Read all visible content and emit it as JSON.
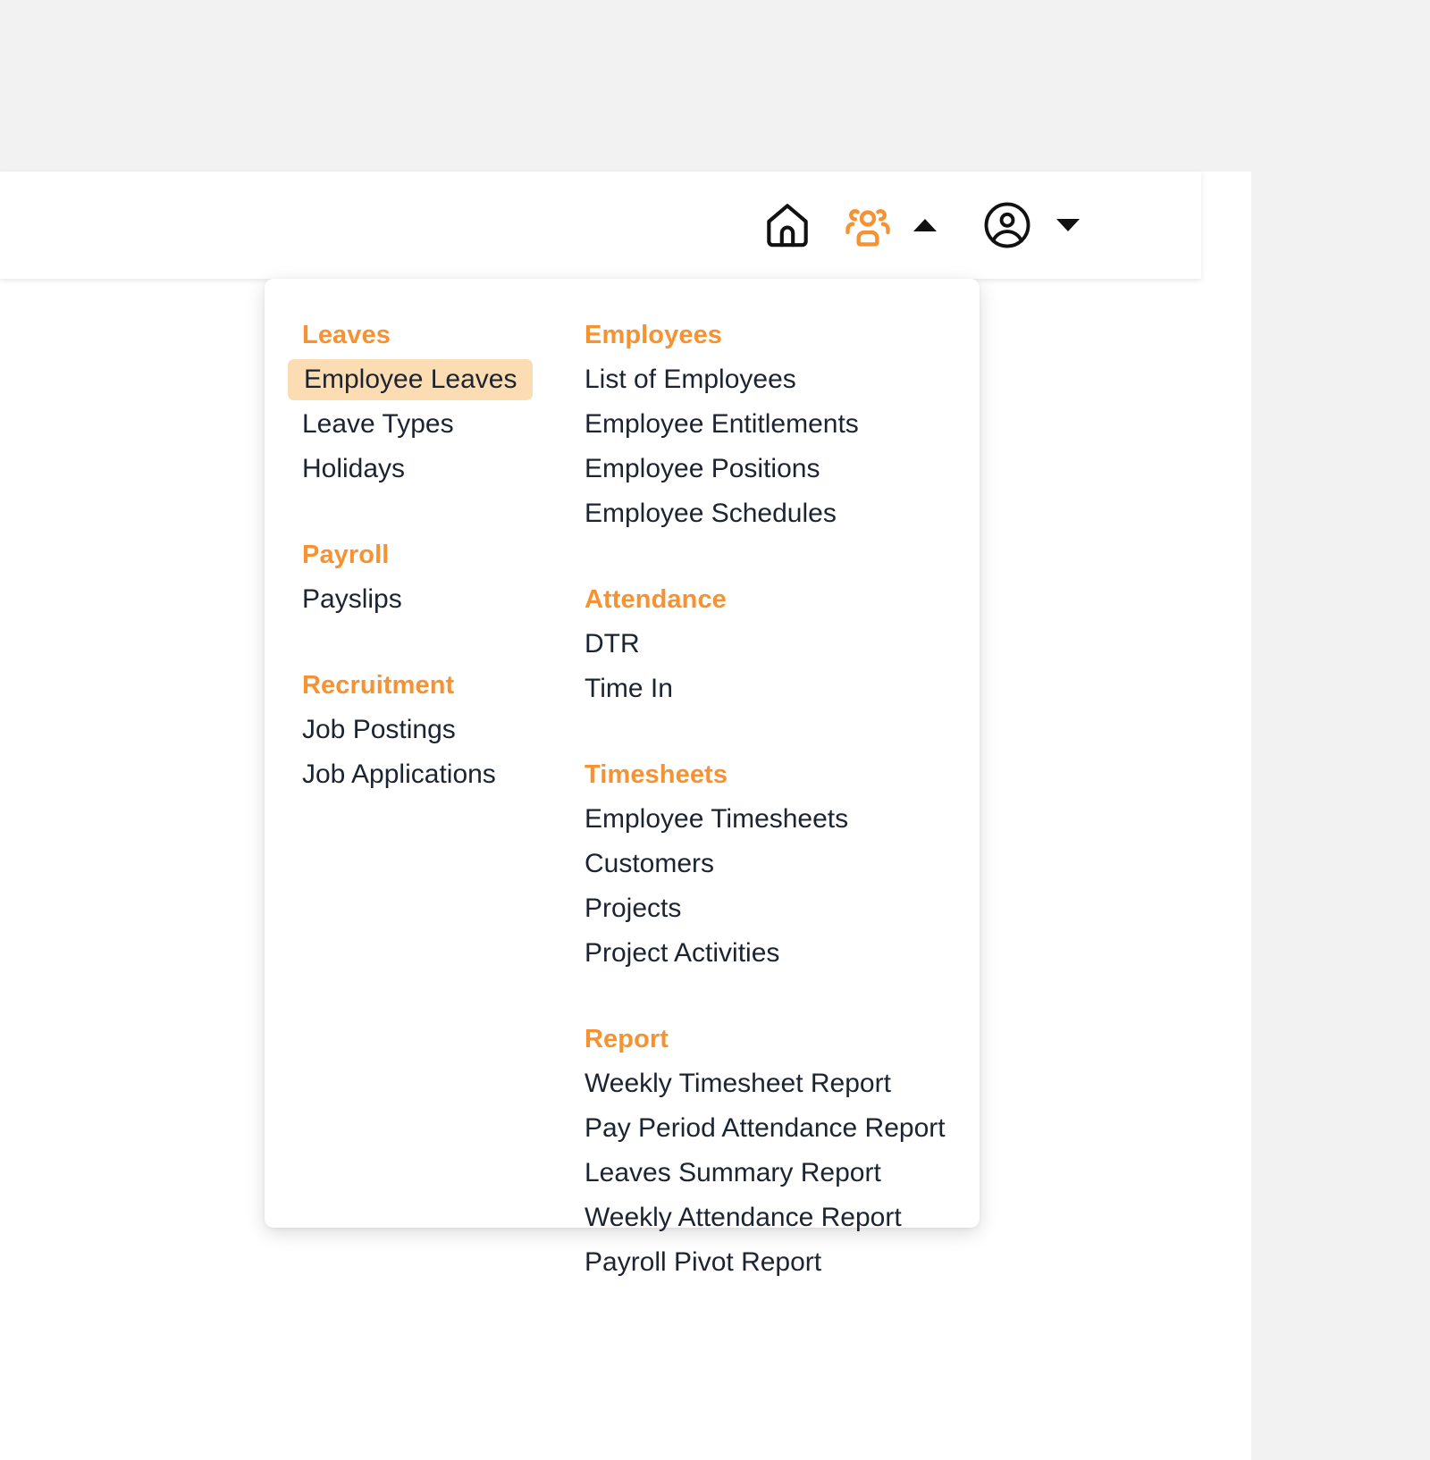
{
  "navbar": {
    "icons": [
      {
        "name": "home-icon",
        "label": "Home"
      },
      {
        "name": "hr-users-icon",
        "label": "HR"
      },
      {
        "name": "caret-up-icon",
        "label": "Collapse HR menu"
      },
      {
        "name": "user-circle-icon",
        "label": "Account"
      },
      {
        "name": "caret-down-icon",
        "label": "Open account menu"
      }
    ]
  },
  "menu": {
    "left_column": [
      {
        "title": "Leaves",
        "items": [
          {
            "label": "Employee Leaves",
            "active": true
          },
          {
            "label": "Leave Types",
            "active": false
          },
          {
            "label": "Holidays",
            "active": false
          }
        ]
      },
      {
        "title": "Payroll",
        "items": [
          {
            "label": "Payslips",
            "active": false
          }
        ]
      },
      {
        "title": "Recruitment",
        "items": [
          {
            "label": "Job Postings",
            "active": false
          },
          {
            "label": "Job Applications",
            "active": false
          }
        ]
      }
    ],
    "right_column": [
      {
        "title": "Employees",
        "items": [
          {
            "label": "List of Employees",
            "active": false
          },
          {
            "label": "Employee Entitlements",
            "active": false
          },
          {
            "label": "Employee Positions",
            "active": false
          },
          {
            "label": "Employee Schedules",
            "active": false
          }
        ]
      },
      {
        "title": "Attendance",
        "items": [
          {
            "label": "DTR",
            "active": false
          },
          {
            "label": "Time In",
            "active": false
          }
        ]
      },
      {
        "title": "Timesheets",
        "items": [
          {
            "label": "Employee Timesheets",
            "active": false
          },
          {
            "label": "Customers",
            "active": false
          },
          {
            "label": "Projects",
            "active": false
          },
          {
            "label": "Project Activities",
            "active": false
          }
        ]
      },
      {
        "title": "Report",
        "items": [
          {
            "label": "Weekly Timesheet Report",
            "active": false
          },
          {
            "label": "Pay Period Attendance Report",
            "active": false
          },
          {
            "label": "Leaves Summary Report",
            "active": false
          },
          {
            "label": "Weekly Attendance Report",
            "active": false
          },
          {
            "label": "Payroll Pivot Report",
            "active": false
          }
        ]
      }
    ]
  },
  "colors": {
    "accent": "#f79232",
    "active_highlight": "#fbdcb3",
    "text": "#1b2430",
    "page_background": "#f2f2f2",
    "surface": "#ffffff"
  }
}
